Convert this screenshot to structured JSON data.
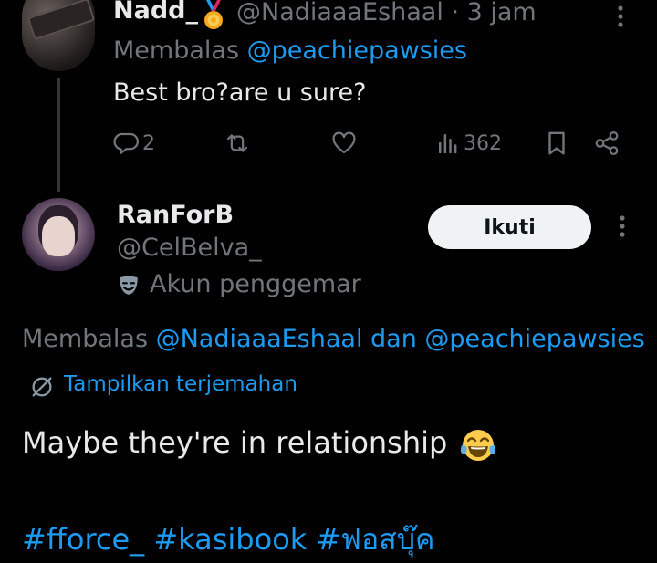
{
  "reply": {
    "display_name": "Nadd_",
    "medal_emoji": "medal-icon",
    "handle": "@NadiaaaEshaal",
    "separator": " · ",
    "time": "3 jam",
    "replying_prefix": "Membalas ",
    "replying_to": "@peachiepawsies",
    "text": "Best bro?are u sure?",
    "actions": {
      "reply_count": "2",
      "retweet_count": "",
      "like_count": "",
      "views_count": "362"
    }
  },
  "tweet": {
    "display_name": "RanForB",
    "handle": "@CelBelva_",
    "badge_label": "Akun penggemar",
    "follow_label": "Ikuti",
    "replying_prefix": "Membalas ",
    "replying_to_1": "@NadiaaaEshaal",
    "replying_and": " dan ",
    "replying_to_2": "@peachiepawsies",
    "translate_label": "Tampilkan terjemahan",
    "text": "Maybe they're in relationship",
    "emoji": "face-with-tears-of-joy-icon",
    "hashtags": [
      "#fforce_",
      "#kasibook",
      "#ฟอสบุ๊ค"
    ]
  },
  "colors": {
    "background": "#000000",
    "text": "#e7e9ea",
    "muted": "#71767b",
    "link": "#1d9bf0",
    "thread_line": "#333639",
    "button_bg": "#eff3f4"
  }
}
